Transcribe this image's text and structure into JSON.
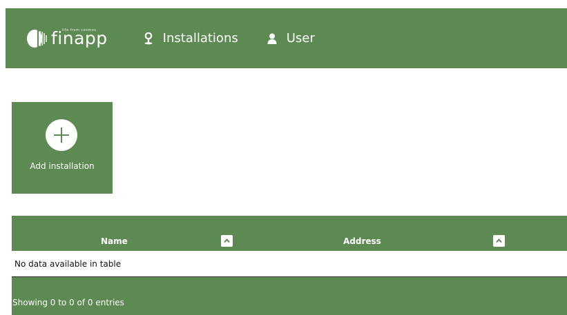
{
  "navbar": {
    "brand_name": "finapp",
    "brand_tagline": "life from cosmos",
    "items": [
      {
        "label": "Installations",
        "icon": "pin-icon"
      },
      {
        "label": "User",
        "icon": "user-icon"
      }
    ]
  },
  "tile": {
    "label": "Add installation",
    "icon": "plus-circle-icon"
  },
  "table": {
    "columns": [
      {
        "label": "Name"
      },
      {
        "label": "Address"
      }
    ],
    "empty_message": "No data available in table",
    "info": "Showing 0 to 0 of 0 entries"
  },
  "colors": {
    "primary": "#5d8a52",
    "background": "#ffffff",
    "text": "#111111"
  }
}
